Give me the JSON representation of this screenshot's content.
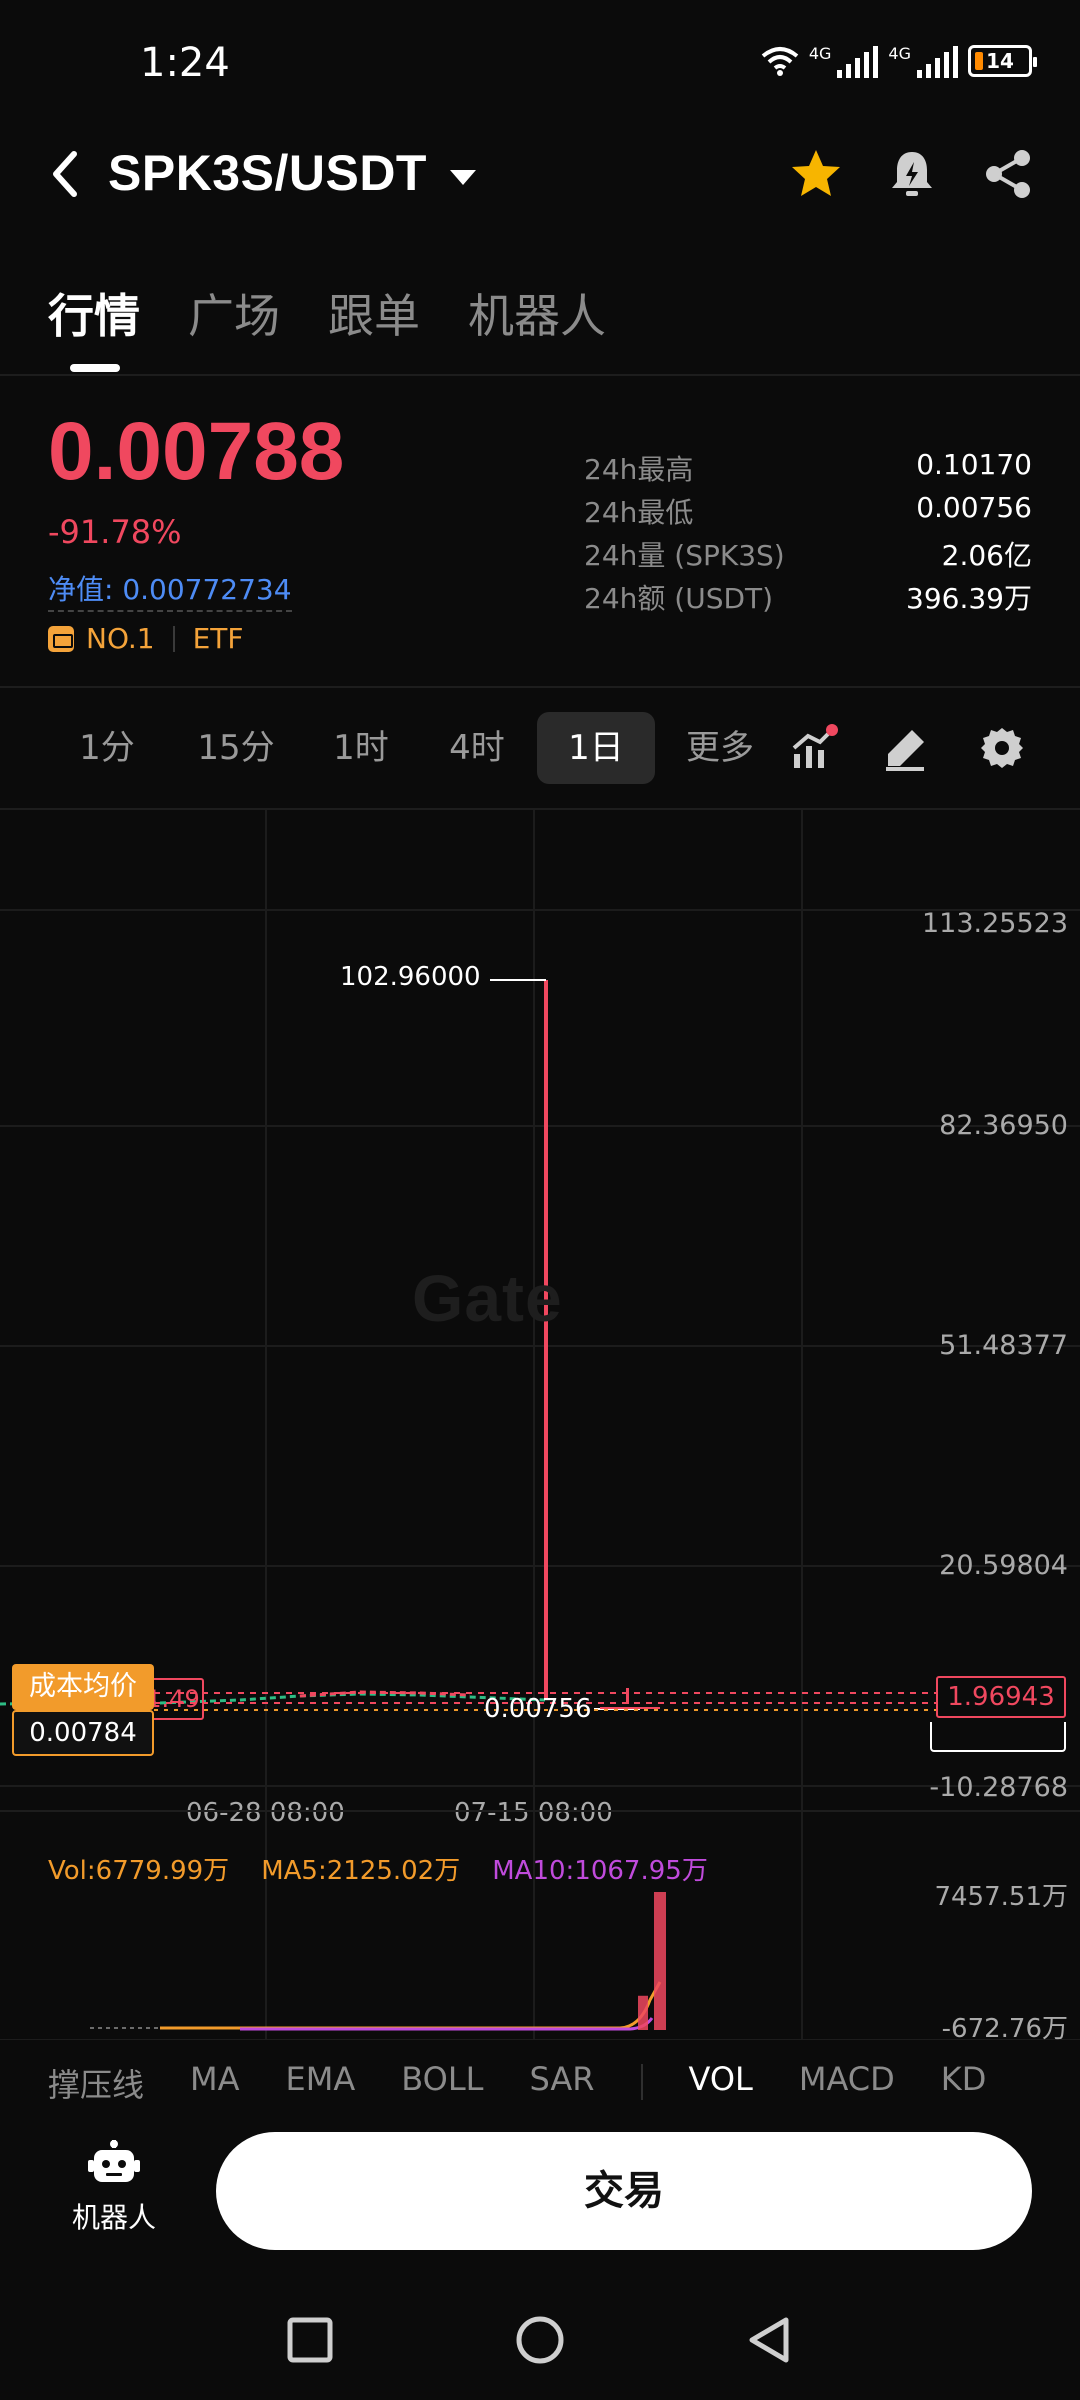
{
  "status_bar": {
    "time": "1:24",
    "network_1": "4G",
    "network_2": "4G",
    "battery": "14"
  },
  "header": {
    "pair": "SPK3S/USDT",
    "icons": [
      "back-arrow-icon",
      "star-icon",
      "bell-alert-icon",
      "share-icon"
    ]
  },
  "nav_tabs": [
    "行情",
    "广场",
    "跟单",
    "机器人"
  ],
  "price": {
    "last": "0.00788",
    "change": "-91.78%",
    "nav": "净值: 0.00772734",
    "rank": "NO.1",
    "tag": "ETF"
  },
  "stats": [
    {
      "label": "24h最高",
      "value": "0.10170"
    },
    {
      "label": "24h最低",
      "value": "0.00756"
    },
    {
      "label": "24h量 (SPK3S)",
      "value": "2.06亿"
    },
    {
      "label": "24h额 (USDT)",
      "value": "396.39万"
    }
  ],
  "intervals": {
    "i1": "1分",
    "i2": "15分",
    "i3": "1时",
    "i4": "4时",
    "i5": "1日",
    "more": "更多",
    "active": "1日"
  },
  "chart_data": {
    "type": "line",
    "watermark": "Gate",
    "y_ticks": [
      "113.25523",
      "82.36950",
      "51.48377",
      "20.59804",
      "-10.28768"
    ],
    "y_range": [
      -10.28768,
      113.25523
    ],
    "x_ticks": [
      "06-28 08:00",
      "07-15 08:00"
    ],
    "peak": "102.96000",
    "low": "0.00756",
    "cost_label": "成本均价",
    "cost_value": "0.00784",
    "left_price_tag": "1.49",
    "current_price_tag": "1.96943",
    "colors": {
      "up": "#2ebd85",
      "down": "#f0485f",
      "grid": "#1c1c1c"
    }
  },
  "volume": {
    "vol": "Vol:6779.99万",
    "ma5": "MA5:2125.02万",
    "ma10": "MA10:1067.95万",
    "y_ticks": [
      "7457.51万",
      "-672.76万"
    ],
    "bars": [
      1850,
      7457.51
    ]
  },
  "indicators": {
    "main": [
      "撑压线",
      "MA",
      "EMA",
      "BOLL",
      "SAR"
    ],
    "sub": [
      "VOL",
      "MACD",
      "KD"
    ],
    "active": "VOL"
  },
  "bottom": {
    "robot": "机器人",
    "trade": "交易"
  }
}
